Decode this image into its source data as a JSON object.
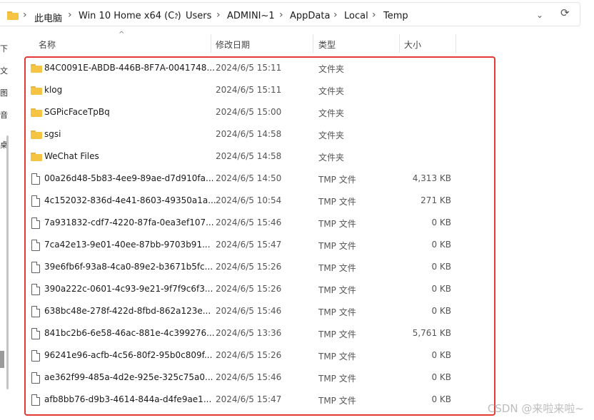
{
  "address": {
    "crumbs": [
      "此电脑",
      "Win 10 Home x64 (C:)",
      "Users",
      "ADMINI~1",
      "AppData",
      "Local",
      "Temp"
    ]
  },
  "nav": {
    "chars": [
      "下",
      "文",
      "图",
      "音",
      "桌"
    ]
  },
  "columns": {
    "name": "名称",
    "date": "修改日期",
    "type": "类型",
    "size": "大小"
  },
  "files": [
    {
      "kind": "folder",
      "name": "84C0091E-ABDB-446B-8F7A-0041748...",
      "date": "2024/6/5 15:11",
      "type": "文件夹",
      "size": ""
    },
    {
      "kind": "folder",
      "name": "klog",
      "date": "2024/6/5 15:11",
      "type": "文件夹",
      "size": ""
    },
    {
      "kind": "folder",
      "name": "SGPicFaceTpBq",
      "date": "2024/6/5 15:00",
      "type": "文件夹",
      "size": ""
    },
    {
      "kind": "folder",
      "name": "sgsi",
      "date": "2024/6/5 14:58",
      "type": "文件夹",
      "size": ""
    },
    {
      "kind": "folder",
      "name": "WeChat Files",
      "date": "2024/6/5 14:58",
      "type": "文件夹",
      "size": ""
    },
    {
      "kind": "file",
      "name": "00a26d48-5b83-4ee9-89ae-d7d910fa...",
      "date": "2024/6/5 14:50",
      "type": "TMP 文件",
      "size": "4,313 KB"
    },
    {
      "kind": "file",
      "name": "4c152032-836d-4e41-8603-49350a1a...",
      "date": "2024/6/5 10:54",
      "type": "TMP 文件",
      "size": "271 KB"
    },
    {
      "kind": "file",
      "name": "7a931832-cdf7-4220-87fa-0ea3ef107...",
      "date": "2024/6/5 15:46",
      "type": "TMP 文件",
      "size": "0 KB"
    },
    {
      "kind": "file",
      "name": "7ca42e13-9e01-40ee-87bb-9703b91...",
      "date": "2024/6/5 15:47",
      "type": "TMP 文件",
      "size": "0 KB"
    },
    {
      "kind": "file",
      "name": "39e6fb6f-93a8-4ca0-89e2-b3671b5fc...",
      "date": "2024/6/5 15:26",
      "type": "TMP 文件",
      "size": "0 KB"
    },
    {
      "kind": "file",
      "name": "390a222c-0601-4c93-9e21-9f7f9c6f3...",
      "date": "2024/6/5 15:26",
      "type": "TMP 文件",
      "size": "0 KB"
    },
    {
      "kind": "file",
      "name": "638bc48e-278f-422d-8fbd-862a123e...",
      "date": "2024/6/5 15:46",
      "type": "TMP 文件",
      "size": "0 KB"
    },
    {
      "kind": "file",
      "name": "841bc2b6-6e58-46ac-881e-4c399276...",
      "date": "2024/6/5 13:36",
      "type": "TMP 文件",
      "size": "5,761 KB"
    },
    {
      "kind": "file",
      "name": "96241e96-acfb-4c56-80f2-95b0c809f...",
      "date": "2024/6/5 15:26",
      "type": "TMP 文件",
      "size": "0 KB"
    },
    {
      "kind": "file",
      "name": "ae362f99-485a-4d2e-925e-325c75a0...",
      "date": "2024/6/5 15:46",
      "type": "TMP 文件",
      "size": "0 KB"
    },
    {
      "kind": "file",
      "name": "afb8bb76-d9b3-4614-844a-d4fe9ae1...",
      "date": "2024/6/5 15:47",
      "type": "TMP 文件",
      "size": "0 KB"
    }
  ],
  "watermark": "CSDN @来啦来啦~",
  "colors": {
    "highlight": "#e53935",
    "folder": "#f6c443"
  }
}
